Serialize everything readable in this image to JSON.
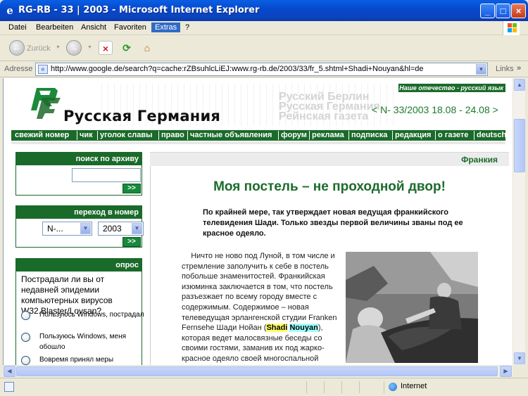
{
  "window": {
    "title": "RG-RB - 33 | 2003 - Microsoft Internet Explorer"
  },
  "menu": [
    "Datei",
    "Bearbeiten",
    "Ansicht",
    "Favoriten",
    "Extras",
    "?"
  ],
  "toolbar": {
    "back_label": "Zurück"
  },
  "address": {
    "label": "Adresse",
    "url": "http://www.google.de/search?q=cache:rZBsuhlcLiEJ:www.rg-rb.de/2003/33/fr_5.shtml+Shadi+Nouyan&hl=de",
    "links_label": "Links",
    "chevron": "»"
  },
  "site": {
    "motto": "Наше отечество - русский язык",
    "title": "Русская Германия",
    "issue": "< N- 33/2003  18.08 - 24.08 >",
    "ghost_lines": [
      "Русский Берлин",
      "Русская Германия",
      "Рейнская газета"
    ],
    "nav": [
      "свежий номер",
      "чик",
      "уголок славы",
      "право",
      "частные объявления",
      "форум",
      "реклама",
      "подписка",
      "редакция",
      "о газете",
      "deutsch"
    ]
  },
  "sidebar": {
    "search": {
      "heading": "поиск по архиву",
      "value": "",
      "go": ">>"
    },
    "jump": {
      "heading": "переход в номер",
      "issue_value": "N-...",
      "year_value": "2003",
      "go": ">>"
    },
    "poll": {
      "heading": "опрос",
      "question": "Пострадали ли вы от недавней эпидемии компьютерных вирусов W32.Blaster/Lovsan?",
      "options": [
        "Пользуюсь Windows, пострадал",
        "Пользуюсь Windows, меня обошло",
        "Вовремя принял меры"
      ]
    }
  },
  "article": {
    "section": "Франкия",
    "title": "Моя постель – не проходной двор!",
    "lead": "По крайней мере, так утверждает новая ведущая франкийского телевидения Шади. Только звезды первой величины званы под ее красное одеяло.",
    "body_before": "Ничто не ново под Луной, в том числе и стремление заполучить к себе в постель побольше знаменитостей. Франкийская изюминка заключается в том, что постель разъезжает по всему городу вместе с содержимым. Содержимое – новая телеведущая эрлангенской студии Franken Fernsehe Шади Нойан (",
    "hl_first": "Shadi",
    "hl_second": "Nouyan",
    "body_after": "), которая ведет малосвязные беседы со своими гостями, заманив их под жарко-красное одеяло своей многоспальной кровати."
  },
  "status": {
    "zone": "Internet"
  }
}
